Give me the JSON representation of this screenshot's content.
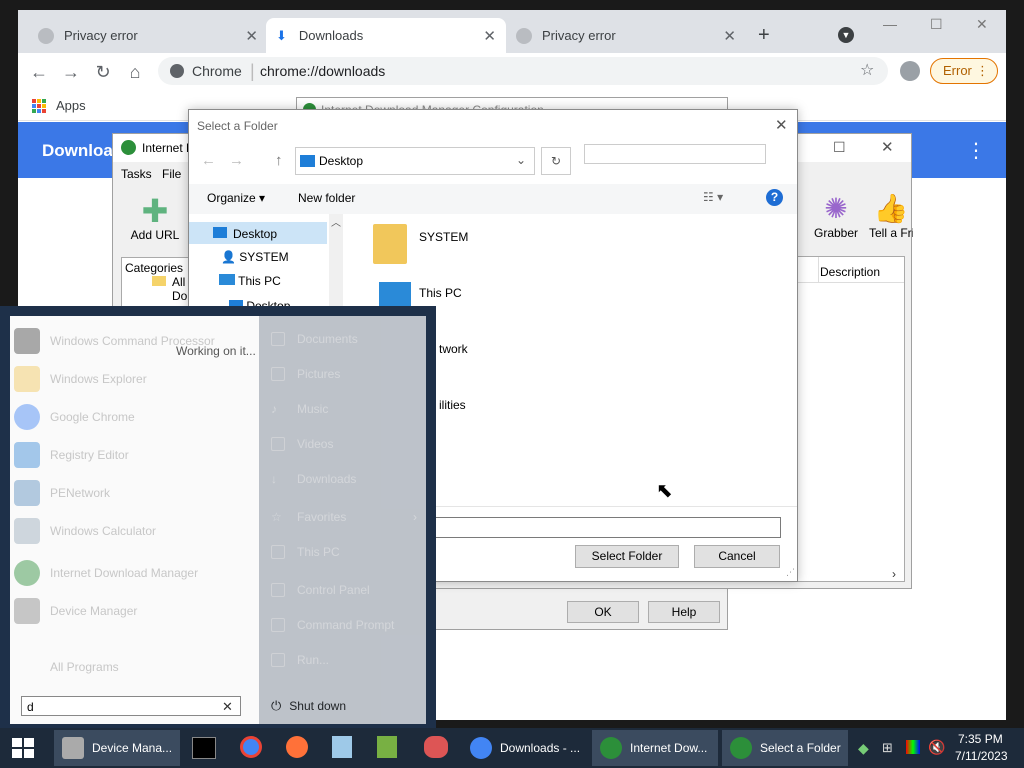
{
  "chrome": {
    "tabs": [
      {
        "label": "Privacy error"
      },
      {
        "label": "Downloads"
      },
      {
        "label": "Privacy error"
      }
    ],
    "address_prefix": "Chrome",
    "address": "chrome://downloads",
    "profile_error": "Error",
    "bookmark_apps": "Apps",
    "page_title": "Download"
  },
  "idm": {
    "title": "Internet D",
    "menu": [
      "Tasks",
      "File"
    ],
    "add_url": "Add URL",
    "grabber": "Grabber",
    "tell_friend": "Tell a Fri",
    "categories": "Categories",
    "all_downloads": "All Do",
    "col_description": "Description"
  },
  "config": {
    "title": "Internet Download Manager Configuration",
    "ok": "OK",
    "help": "Help"
  },
  "select_folder": {
    "title": "Select a Folder",
    "location": "Desktop",
    "organize": "Organize",
    "new_folder": "New folder",
    "tree": [
      "Desktop",
      "SYSTEM",
      "This PC",
      "Desktop"
    ],
    "items": [
      "SYSTEM",
      "This PC",
      "twork",
      "ilities"
    ],
    "select_btn": "Select Folder",
    "cancel_btn": "Cancel"
  },
  "start_menu": {
    "programs": [
      "Windows Command Processor",
      "Windows Explorer",
      "Google Chrome",
      "Registry Editor",
      "PENetwork",
      "Windows Calculator",
      "Internet Download Manager",
      "Device Manager"
    ],
    "working": "Working on it...",
    "all_programs": "All Programs",
    "search_value": "d",
    "places": [
      "Documents",
      "Pictures",
      "Music",
      "Videos",
      "Downloads",
      "Favorites",
      "This PC",
      "Control Panel",
      "Command Prompt",
      "Run..."
    ],
    "shutdown": "Shut down"
  },
  "taskbar": {
    "items": [
      "Device Mana...",
      "Downloads - ...",
      "Internet Dow...",
      "Select a Folder"
    ],
    "time": "7:35 PM",
    "date": "7/11/2023"
  }
}
